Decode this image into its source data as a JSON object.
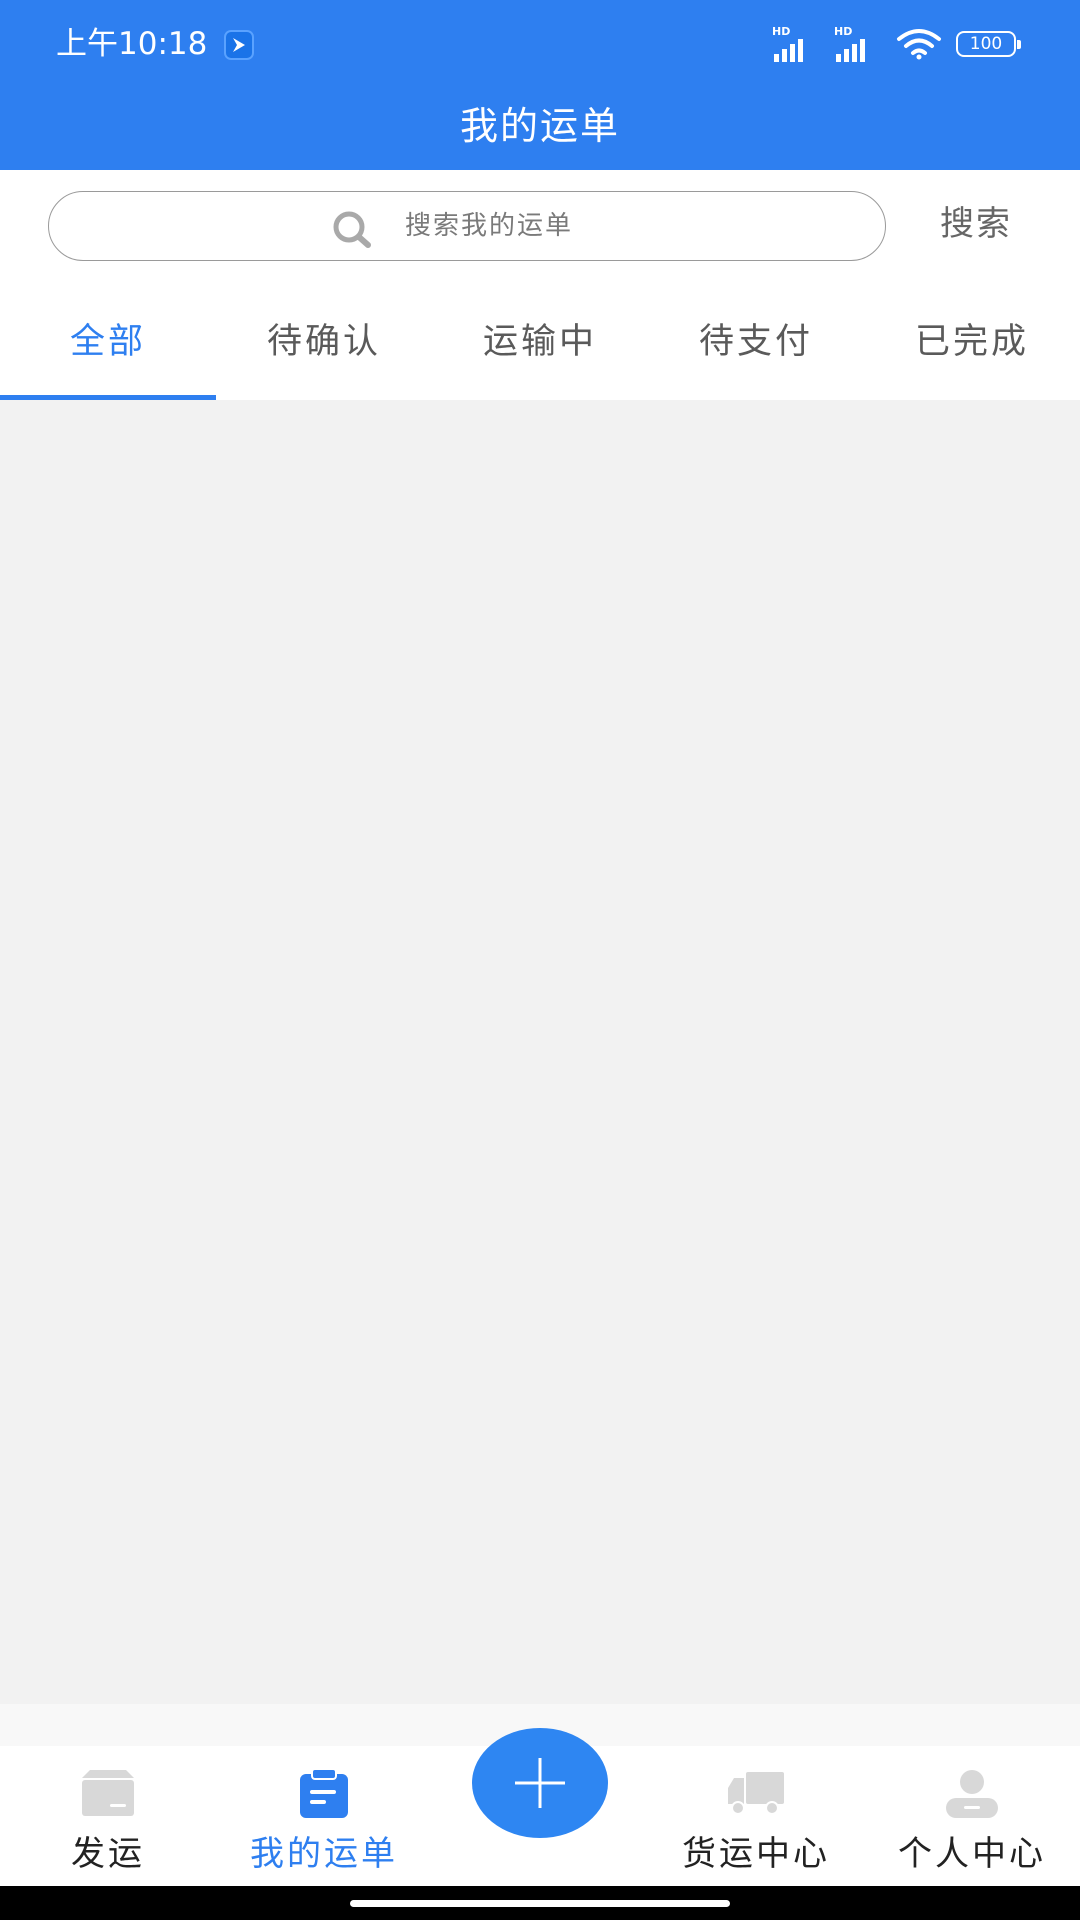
{
  "status_bar": {
    "time": "上午10:18",
    "signal1_label": "HD",
    "signal2_label": "HD",
    "battery": "100"
  },
  "header": {
    "title": "我的运单"
  },
  "search": {
    "placeholder": "搜索我的运单",
    "button_label": "搜索"
  },
  "tabs": [
    {
      "label": "全部",
      "active": true
    },
    {
      "label": "待确认",
      "active": false
    },
    {
      "label": "运输中",
      "active": false
    },
    {
      "label": "待支付",
      "active": false
    },
    {
      "label": "已完成",
      "active": false
    }
  ],
  "bottom_nav": [
    {
      "label": "发运",
      "icon": "package-icon"
    },
    {
      "label": "我的运单",
      "icon": "clipboard-icon",
      "active": true
    },
    {
      "label": "",
      "icon": "plus-icon"
    },
    {
      "label": "货运中心",
      "icon": "truck-icon"
    },
    {
      "label": "个人中心",
      "icon": "user-icon"
    }
  ],
  "colors": {
    "primary": "#2e7ff0",
    "inactive_icon": "#d8d8d8",
    "background": "#f2f2f2"
  }
}
